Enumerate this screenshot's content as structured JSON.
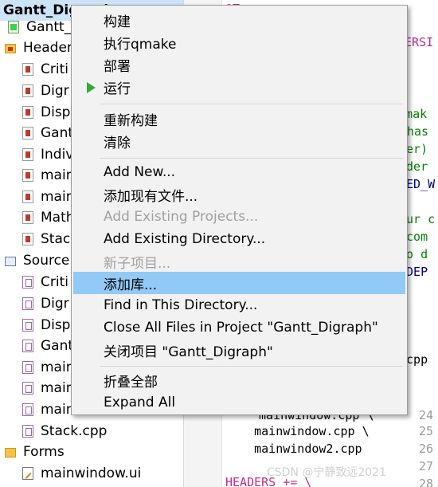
{
  "tree": {
    "items": [
      {
        "label": "Gantt_Digraph",
        "icon": "project-icon"
      },
      {
        "label": "Gantt_D",
        "icon": "pro-file-icon"
      },
      {
        "label": "Header",
        "icon": "headers-folder-icon"
      },
      {
        "label": "Criti",
        "icon": "header-file-icon"
      },
      {
        "label": "Digr",
        "icon": "header-file-icon"
      },
      {
        "label": "Disp",
        "icon": "header-file-icon"
      },
      {
        "label": "Gant",
        "icon": "header-file-icon"
      },
      {
        "label": "Indiv",
        "icon": "header-file-icon"
      },
      {
        "label": "main",
        "icon": "header-file-icon"
      },
      {
        "label": "main",
        "icon": "header-file-icon"
      },
      {
        "label": "Math",
        "icon": "header-file-icon"
      },
      {
        "label": "Stack",
        "icon": "header-file-icon"
      },
      {
        "label": "Source",
        "icon": "sources-folder-icon"
      },
      {
        "label": "Criti",
        "icon": "source-file-icon"
      },
      {
        "label": "Digr",
        "icon": "source-file-icon"
      },
      {
        "label": "Disp",
        "icon": "source-file-icon"
      },
      {
        "label": "Gant",
        "icon": "source-file-icon"
      },
      {
        "label": "main",
        "icon": "source-file-icon"
      },
      {
        "label": "main",
        "icon": "source-file-icon"
      },
      {
        "label": "main",
        "icon": "source-file-icon"
      },
      {
        "label": "Stack.cpp",
        "icon": "source-file-icon"
      },
      {
        "label": "Forms",
        "icon": "forms-folder-icon"
      },
      {
        "label": "mainwindow.ui",
        "icon": "ui-file-icon"
      }
    ]
  },
  "editor": {
    "lines": [
      {
        "num": "",
        "text": "QT",
        "color": "pink"
      },
      {
        "num": "",
        "text": "VERSI",
        "color": "pink"
      },
      {
        "num": "",
        "text": "e mak",
        "color": "green"
      },
      {
        "num": "",
        "text": "has",
        "color": "green"
      },
      {
        "num": "",
        "text": "ler)",
        "color": "green"
      },
      {
        "num": "",
        "text": "rder",
        "color": "green"
      },
      {
        "num": "",
        "text": "TED_W",
        "color": "navy"
      },
      {
        "num": "",
        "text": "our c",
        "color": "green"
      },
      {
        "num": "",
        "text": "ncom",
        "color": "green"
      },
      {
        "num": "",
        "text": "to d",
        "color": "green"
      },
      {
        "num": "",
        "text": "_DEP",
        "color": "navy"
      },
      {
        "num": "",
        "text": ".cpp",
        "color": "black"
      },
      {
        "num": "24",
        "text": "mainwindow.cpp \\",
        "color": "black"
      },
      {
        "num": "25",
        "text": "    mainwindow.cpp \\",
        "color": "black"
      },
      {
        "num": "26",
        "text": "    mainwindow2.cpp",
        "color": "black"
      },
      {
        "num": "27",
        "text": "",
        "color": "black"
      },
      {
        "num": "28",
        "text": "HEADERS += \\",
        "color": "pink"
      }
    ],
    "watermark": "CSDN @宁静致远2021"
  },
  "menu": {
    "items": [
      {
        "label": "构建",
        "disabled": false
      },
      {
        "label": "执行qmake",
        "disabled": false
      },
      {
        "label": "部署",
        "disabled": false
      },
      {
        "label": "运行",
        "disabled": false,
        "icon": "run-icon"
      },
      {
        "label": "重新构建",
        "disabled": false
      },
      {
        "label": "清除",
        "disabled": false
      },
      {
        "label": "Add New...",
        "disabled": false
      },
      {
        "label": "添加现有文件...",
        "disabled": false
      },
      {
        "label": "Add Existing Projects...",
        "disabled": true
      },
      {
        "label": "Add Existing Directory...",
        "disabled": false
      },
      {
        "label": "新子项目...",
        "disabled": true
      },
      {
        "label": "添加库...",
        "disabled": false,
        "highlighted": true
      },
      {
        "label": "Find in This Directory...",
        "disabled": false
      },
      {
        "label": "Close All Files in Project \"Gantt_Digraph\"",
        "disabled": false
      },
      {
        "label": "关闭项目 \"Gantt_Digraph\"",
        "disabled": false
      },
      {
        "label": "折叠全部",
        "disabled": false
      },
      {
        "label": "Expand All",
        "disabled": false
      }
    ]
  },
  "colors": {
    "highlight": "#91c9f7",
    "run_arrow": "#3aa838",
    "disabled_text": "#a0a0a0"
  }
}
